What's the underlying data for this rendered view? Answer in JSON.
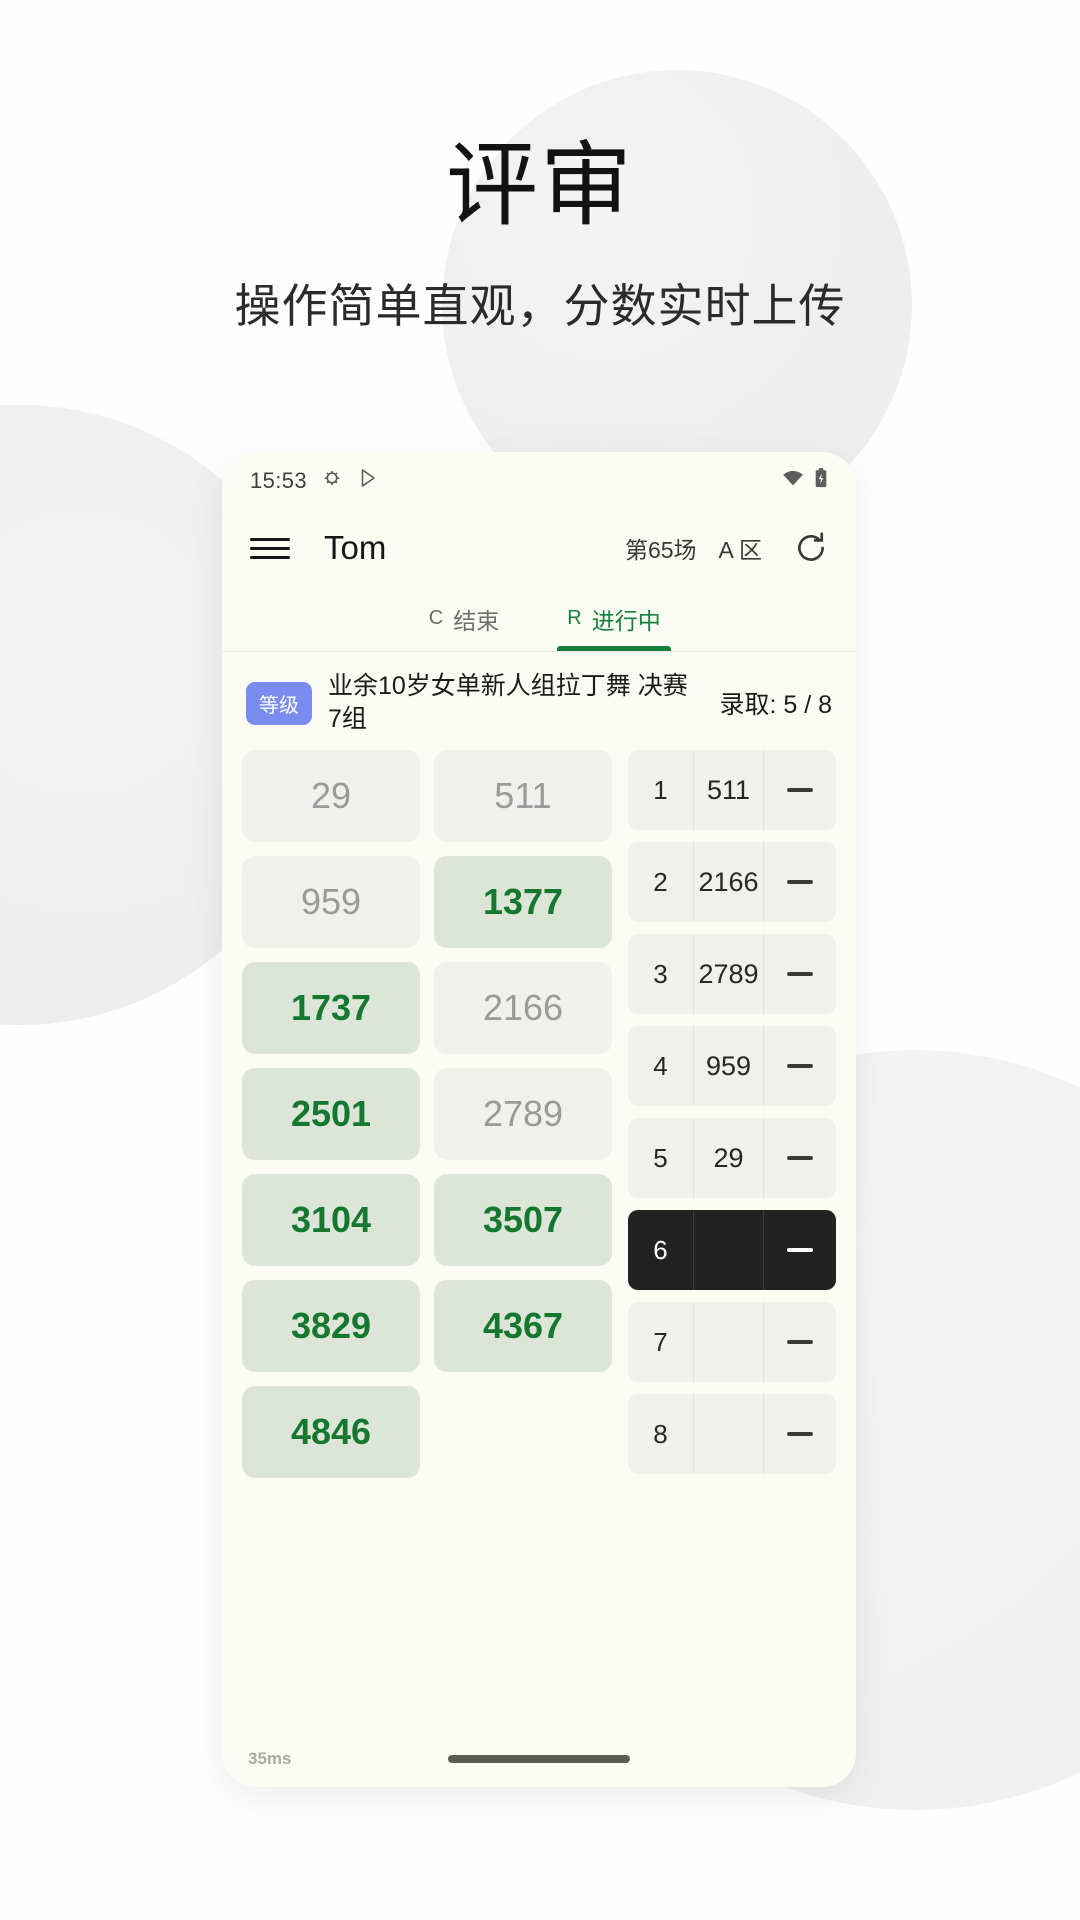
{
  "hero": {
    "title": "评审",
    "subtitle": "操作简单直观，分数实时上传"
  },
  "colors": {
    "accent_green": "#17803d",
    "tile_selected_bg": "#dde5d9",
    "tile_selected_text": "#14782f",
    "tile_unselected_bg": "#f0f1ec",
    "tile_unselected_text": "#9a9a9a",
    "badge_blue": "#7b8cf0",
    "active_row_bg": "#222222",
    "phone_bg": "#fbfcf4"
  },
  "phone": {
    "statusbar": {
      "time": "15:53",
      "icons_left": [
        "bug-icon",
        "play-store-icon"
      ],
      "icons_right": [
        "wifi-icon",
        "battery-charging-icon"
      ]
    },
    "appbar": {
      "menu_icon": "hamburger-menu-icon",
      "title": "Tom",
      "match_label": "第65场",
      "area_label": "A 区",
      "refresh_icon": "refresh-icon"
    },
    "tabs": [
      {
        "code": "C",
        "label": "结束",
        "active": false
      },
      {
        "code": "R",
        "label": "进行中",
        "active": true
      }
    ],
    "event": {
      "badge": "等级",
      "title": "业余10岁女单新人组拉丁舞 决赛 7组",
      "quota_label": "录取: 5 / 8"
    },
    "number_grid": [
      {
        "value": "29",
        "selected": false
      },
      {
        "value": "511",
        "selected": false
      },
      {
        "value": "959",
        "selected": false
      },
      {
        "value": "1377",
        "selected": true
      },
      {
        "value": "1737",
        "selected": true
      },
      {
        "value": "2166",
        "selected": false
      },
      {
        "value": "2501",
        "selected": true
      },
      {
        "value": "2789",
        "selected": false
      },
      {
        "value": "3104",
        "selected": true
      },
      {
        "value": "3507",
        "selected": true
      },
      {
        "value": "3829",
        "selected": true
      },
      {
        "value": "4367",
        "selected": true
      },
      {
        "value": "4846",
        "selected": true
      }
    ],
    "rank_list": [
      {
        "rank": "1",
        "value": "511",
        "score": "—",
        "active": false
      },
      {
        "rank": "2",
        "value": "2166",
        "score": "—",
        "active": false
      },
      {
        "rank": "3",
        "value": "2789",
        "score": "—",
        "active": false
      },
      {
        "rank": "4",
        "value": "959",
        "score": "—",
        "active": false
      },
      {
        "rank": "5",
        "value": "29",
        "score": "—",
        "active": false
      },
      {
        "rank": "6",
        "value": "",
        "score": "—",
        "active": true
      },
      {
        "rank": "7",
        "value": "",
        "score": "—",
        "active": false
      },
      {
        "rank": "8",
        "value": "",
        "score": "—",
        "active": false
      }
    ],
    "footer": {
      "latency": "35ms",
      "home_indicator": "home-indicator"
    }
  }
}
